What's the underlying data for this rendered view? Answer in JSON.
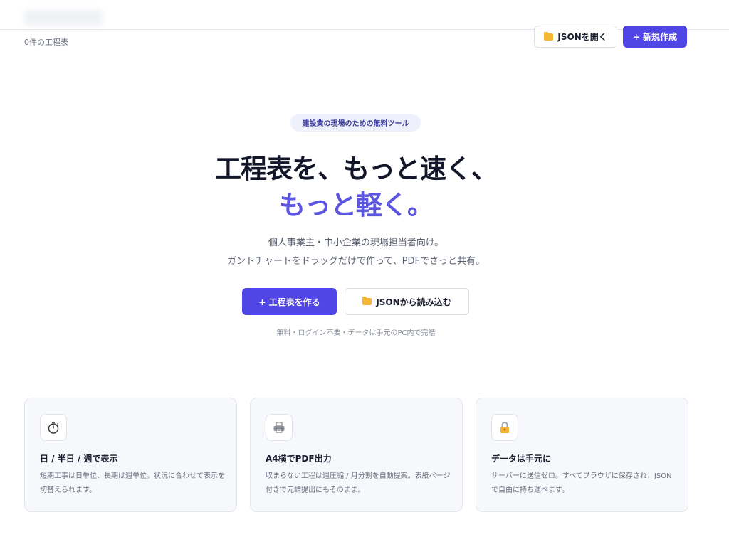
{
  "header": {
    "doc_count": "0件の工程表",
    "open_json_label": "JSONを開く",
    "new_label": "+ 新規作成"
  },
  "hero": {
    "badge": "建設業の現場のための無料ツール",
    "title_line1": "工程表を、もっと速く、",
    "title_line2": "もっと軽く。",
    "lead_line1": "個人事業主・中小企業の現場担当者向け。",
    "lead_line2": "ガントチャートをドラッグだけで作って、PDFでさっと共有。",
    "create_label": "+ 工程表を作る",
    "import_label": "JSONから読み込む",
    "note": "無料・ログイン不要・データは手元のPC内で完結"
  },
  "features": [
    {
      "icon": "stopwatch-icon",
      "title": "日 / 半日 / 週で表示",
      "desc": "短期工事は日単位、長期は週単位。状況に合わせて表示を切替えられます。"
    },
    {
      "icon": "printer-icon",
      "title": "A4横でPDF出力",
      "desc": "収まらない工程は週圧縮 / 月分割を自動提案。表紙ページ付きで元請提出にもそのまま。"
    },
    {
      "icon": "lock-icon",
      "title": "データは手元に",
      "desc": "サーバーに送信ゼロ。すべてブラウザに保存され、JSONで自由に持ち運べます。"
    }
  ],
  "colors": {
    "accent": "#5046e5",
    "title_accent": "#5b55e0",
    "folder": "#f5b731"
  }
}
